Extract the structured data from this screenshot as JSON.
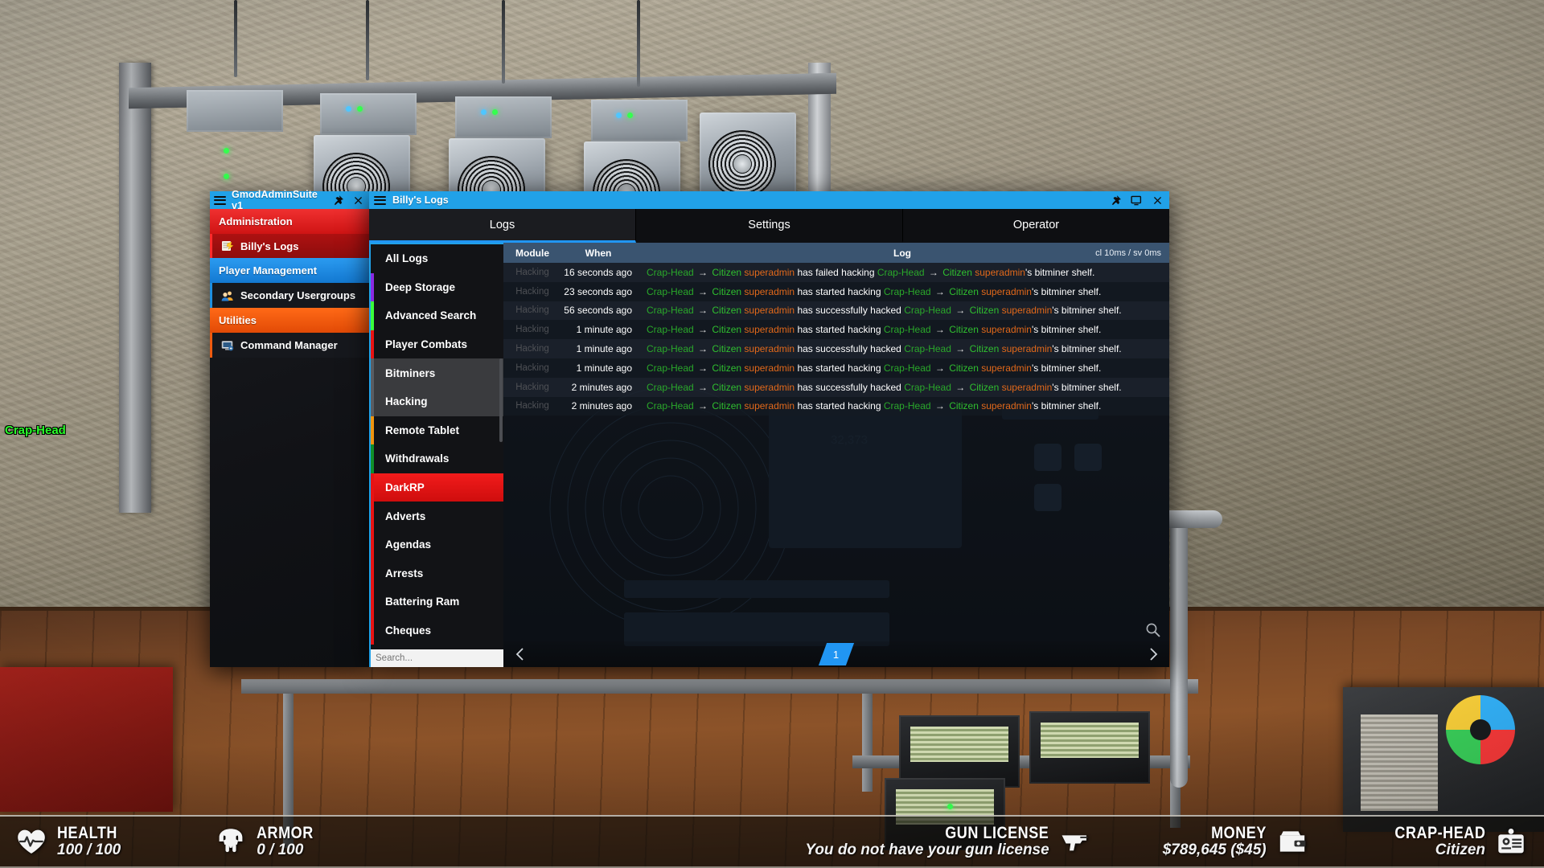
{
  "game": {
    "nametag": "Crap-Head",
    "hud": {
      "health": {
        "label": "HEALTH",
        "value": "100 / 100",
        "icon": "heart-icon"
      },
      "armor": {
        "label": "ARMOR",
        "value": "0 / 100",
        "icon": "helmet-icon"
      },
      "gun_license": {
        "label": "GUN LICENSE",
        "value": "You do not have your gun license",
        "icon": "pistol-icon"
      },
      "money": {
        "label": "MONEY",
        "value": "$789,645 ($45)",
        "icon": "wallet-icon"
      },
      "job": {
        "label": "CRAP-HEAD",
        "value": "Citizen",
        "icon": "id-card-icon"
      }
    }
  },
  "admin_window": {
    "title": "GmodAdminSuite v1",
    "titlebar_color": "#21a1e8",
    "menu_icon": "hamburger-icon",
    "pin_icon": "pin-icon",
    "close_icon": "close-icon",
    "categories": [
      {
        "label": "Administration",
        "type": "header",
        "color": "#e02020"
      },
      {
        "label": "Billy's Logs",
        "type": "item",
        "color": "#b51212",
        "accent": "#ff2b2b",
        "icon": "logs-icon",
        "emoji": "📜"
      },
      {
        "label": "Player Management",
        "type": "header",
        "color": "#1e8fe0"
      },
      {
        "label": "Secondary Usergroups",
        "type": "item",
        "color": "#14171c",
        "accent": "#1e8fe0",
        "icon": "users-icon",
        "emoji": "👥"
      },
      {
        "label": "Utilities",
        "type": "header",
        "color": "#ef5b10"
      },
      {
        "label": "Command Manager",
        "type": "item",
        "color": "#14171c",
        "accent": "#ef5b10",
        "icon": "console-icon",
        "emoji": "🖥"
      }
    ]
  },
  "logs_window": {
    "title": "Billy's Logs",
    "titlebar_color": "#21a1e8",
    "menu_icon": "hamburger-icon",
    "pin_icon": "pin-icon",
    "maximize_icon": "maximize-icon",
    "close_icon": "close-icon",
    "tabs": [
      {
        "label": "Logs",
        "active": true
      },
      {
        "label": "Settings",
        "active": false
      },
      {
        "label": "Operator",
        "active": false
      }
    ],
    "nav": [
      {
        "label": "All Logs",
        "accent": "transparent",
        "selected": false
      },
      {
        "label": "Deep Storage",
        "accent": "#8a2be2",
        "selected": false
      },
      {
        "label": "Advanced Search",
        "accent": "#3bff3b",
        "selected": false
      },
      {
        "label": "Player Combats",
        "accent": "#e81313",
        "selected": false
      },
      {
        "label": "Bitminers",
        "accent": "#5a5d63",
        "selected": true
      },
      {
        "label": "Hacking",
        "accent": "#5a5d63",
        "selected": true
      },
      {
        "label": "Remote Tablet",
        "accent": "#ef9510",
        "selected": false
      },
      {
        "label": "Withdrawals",
        "accent": "#108f2a",
        "selected": false
      },
      {
        "label": "DarkRP",
        "accent": "#e81313",
        "section": true,
        "selected": false
      },
      {
        "label": "Adverts",
        "accent": "#e81313",
        "selected": false
      },
      {
        "label": "Agendas",
        "accent": "#e81313",
        "selected": false
      },
      {
        "label": "Arrests",
        "accent": "#e81313",
        "selected": false
      },
      {
        "label": "Battering Ram",
        "accent": "#e81313",
        "selected": false
      },
      {
        "label": "Cheques",
        "accent": "#e81313",
        "selected": false
      }
    ],
    "search": {
      "placeholder": "Search...",
      "value": ""
    },
    "table": {
      "columns": [
        "Module",
        "When",
        "Log"
      ],
      "perf": "cl 10ms / sv 0ms",
      "rows": [
        {
          "module": "Hacking",
          "when": "16 seconds ago",
          "actor_a": "Crap-Head",
          "actor_a_job": "Citizen",
          "actor_a_rank": "superadmin",
          "verb": "has failed hacking",
          "actor_b": "Crap-Head",
          "actor_b_job": "Citizen",
          "actor_b_rank": "superadmin",
          "suffix": "'s bitminer shelf."
        },
        {
          "module": "Hacking",
          "when": "23 seconds ago",
          "actor_a": "Crap-Head",
          "actor_a_job": "Citizen",
          "actor_a_rank": "superadmin",
          "verb": "has started hacking",
          "actor_b": "Crap-Head",
          "actor_b_job": "Citizen",
          "actor_b_rank": "superadmin",
          "suffix": "'s bitminer shelf."
        },
        {
          "module": "Hacking",
          "when": "56 seconds ago",
          "actor_a": "Crap-Head",
          "actor_a_job": "Citizen",
          "actor_a_rank": "superadmin",
          "verb": "has successfully hacked",
          "actor_b": "Crap-Head",
          "actor_b_job": "Citizen",
          "actor_b_rank": "superadmin",
          "suffix": "'s bitminer shelf."
        },
        {
          "module": "Hacking",
          "when": "1 minute ago",
          "actor_a": "Crap-Head",
          "actor_a_job": "Citizen",
          "actor_a_rank": "superadmin",
          "verb": "has started hacking",
          "actor_b": "Crap-Head",
          "actor_b_job": "Citizen",
          "actor_b_rank": "superadmin",
          "suffix": "'s bitminer shelf."
        },
        {
          "module": "Hacking",
          "when": "1 minute ago",
          "actor_a": "Crap-Head",
          "actor_a_job": "Citizen",
          "actor_a_rank": "superadmin",
          "verb": "has successfully hacked",
          "actor_b": "Crap-Head",
          "actor_b_job": "Citizen",
          "actor_b_rank": "superadmin",
          "suffix": "'s bitminer shelf."
        },
        {
          "module": "Hacking",
          "when": "1 minute ago",
          "actor_a": "Crap-Head",
          "actor_a_job": "Citizen",
          "actor_a_rank": "superadmin",
          "verb": "has started hacking",
          "actor_b": "Crap-Head",
          "actor_b_job": "Citizen",
          "actor_b_rank": "superadmin",
          "suffix": "'s bitminer shelf."
        },
        {
          "module": "Hacking",
          "when": "2 minutes ago",
          "actor_a": "Crap-Head",
          "actor_a_job": "Citizen",
          "actor_a_rank": "superadmin",
          "verb": "has successfully hacked",
          "actor_b": "Crap-Head",
          "actor_b_job": "Citizen",
          "actor_b_rank": "superadmin",
          "suffix": "'s bitminer shelf."
        },
        {
          "module": "Hacking",
          "when": "2 minutes ago",
          "actor_a": "Crap-Head",
          "actor_a_job": "Citizen",
          "actor_a_rank": "superadmin",
          "verb": "has started hacking",
          "actor_b": "Crap-Head",
          "actor_b_job": "Citizen",
          "actor_b_rank": "superadmin",
          "suffix": "'s bitminer shelf."
        }
      ]
    },
    "pagination": {
      "prev_icon": "chevron-left-icon",
      "next_icon": "chevron-right-icon",
      "current_page": "1"
    },
    "search_icon": "magnify-icon"
  }
}
